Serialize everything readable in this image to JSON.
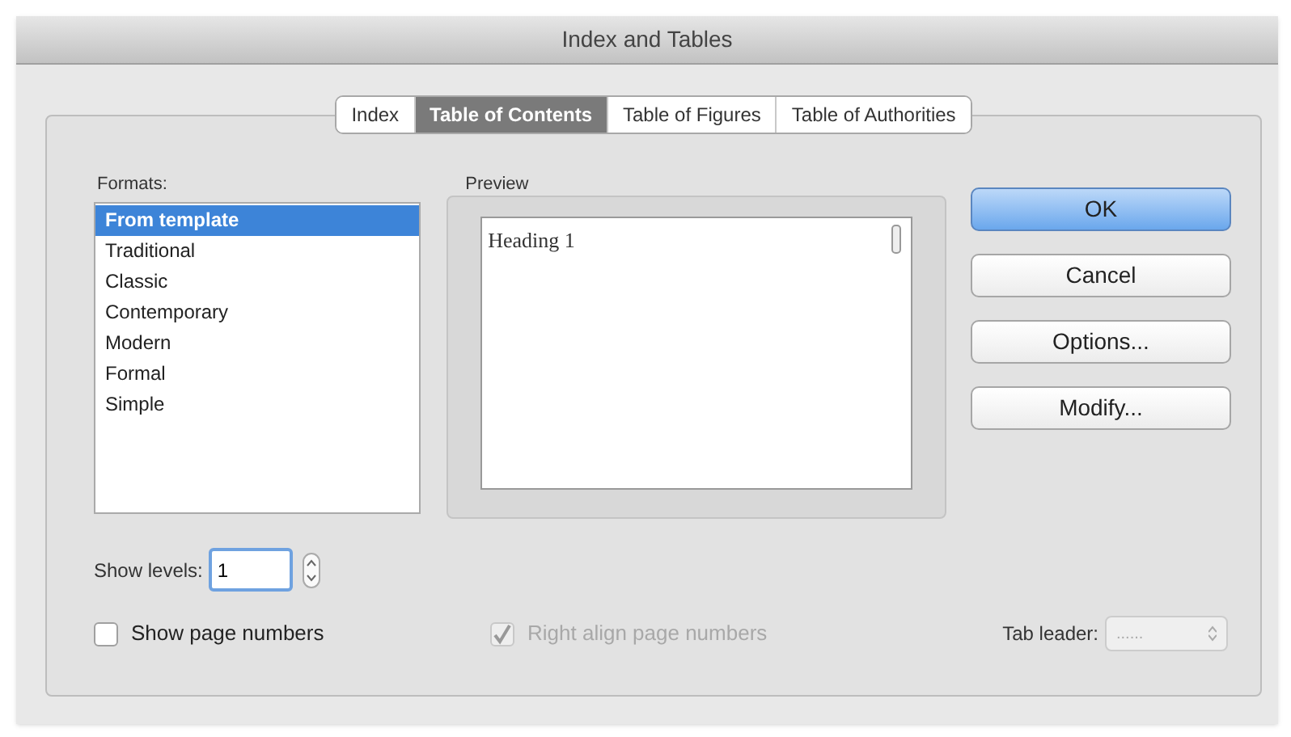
{
  "window": {
    "title": "Index and Tables"
  },
  "tabs": [
    {
      "label": "Index",
      "selected": false
    },
    {
      "label": "Table of Contents",
      "selected": true
    },
    {
      "label": "Table of Figures",
      "selected": false
    },
    {
      "label": "Table of Authorities",
      "selected": false
    }
  ],
  "formats": {
    "label": "Formats:",
    "items": [
      {
        "label": "From template",
        "selected": true
      },
      {
        "label": "Traditional",
        "selected": false
      },
      {
        "label": "Classic",
        "selected": false
      },
      {
        "label": "Contemporary",
        "selected": false
      },
      {
        "label": "Modern",
        "selected": false
      },
      {
        "label": "Formal",
        "selected": false
      },
      {
        "label": "Simple",
        "selected": false
      }
    ]
  },
  "preview": {
    "label": "Preview",
    "text": "Heading 1"
  },
  "buttons": [
    {
      "label": "OK",
      "kind": "default"
    },
    {
      "label": "Cancel",
      "kind": "normal"
    },
    {
      "label": "Options...",
      "kind": "normal"
    },
    {
      "label": "Modify...",
      "kind": "normal"
    }
  ],
  "show_levels": {
    "label": "Show levels:",
    "value": "1"
  },
  "checkboxes": [
    {
      "label": "Show page numbers",
      "checked": false,
      "disabled": false
    },
    {
      "label": "Right align page numbers",
      "checked": true,
      "disabled": true
    }
  ],
  "tab_leader": {
    "label": "Tab leader:",
    "value": "......",
    "disabled": true
  }
}
